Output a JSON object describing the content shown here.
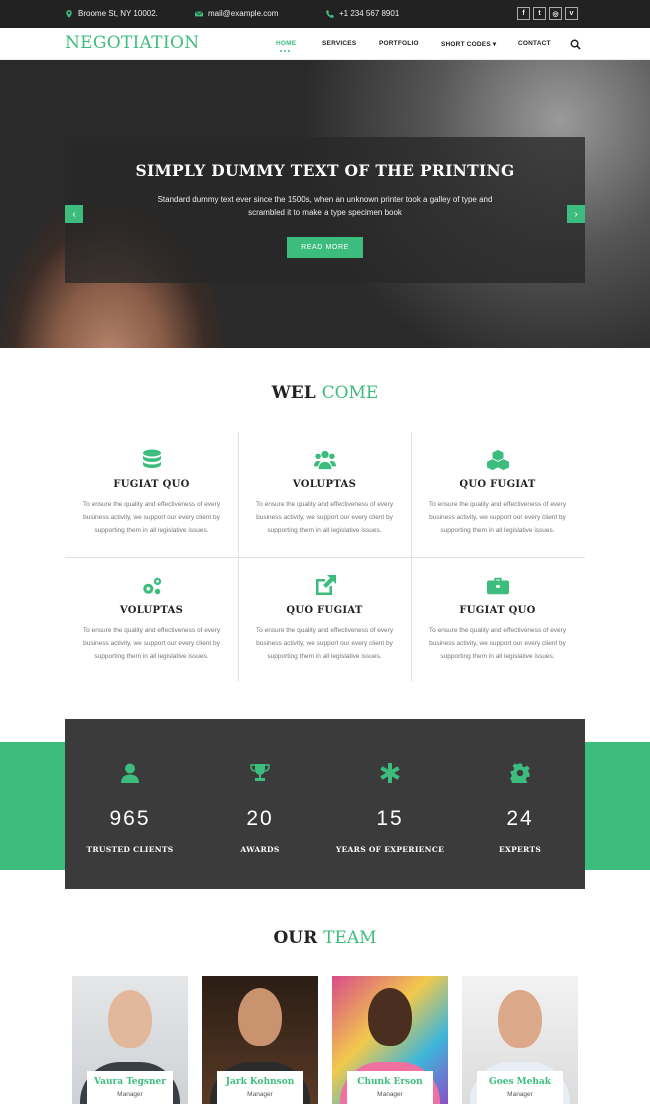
{
  "topbar": {
    "address": "Broome St, NY 10002.",
    "email": "mail@example.com",
    "phone": "+1 234 567 8901",
    "social": [
      "f",
      "t",
      "◎",
      "v"
    ]
  },
  "nav": {
    "logo": "NEGOTIATION",
    "items": [
      "HOME",
      "SERVICES",
      "PORTFOLIO",
      "SHORT CODES ▾",
      "CONTACT"
    ],
    "active": "HOME"
  },
  "hero": {
    "title": "SIMPLY DUMMY TEXT OF THE PRINTING",
    "text": "Standard dummy text ever since the 1500s, when an unknown printer took a galley of type and scrambled it to make a type specimen book",
    "button": "READ MORE",
    "prev": "‹",
    "next": "›"
  },
  "welcome": {
    "title_a": "WEL",
    "title_b": "COME",
    "features": [
      {
        "icon": "database-icon",
        "title": "FUGIAT QUO",
        "text": "To ensure the quality and effectiveness of every business activity, we support our every client by supporting them in all legislative issues."
      },
      {
        "icon": "users-icon",
        "title": "VOLUPTAS",
        "text": "To ensure the quality and effectiveness of every business activity, we support our every client by supporting them in all legislative issues."
      },
      {
        "icon": "cubes-icon",
        "title": "QUO FUGIAT",
        "text": "To ensure the quality and effectiveness of every business activity, we support our every client by supporting them in all legislative issues."
      },
      {
        "icon": "cogs-icon",
        "title": "VOLUPTAS",
        "text": "To ensure the quality and effectiveness of every business activity, we support our every client by supporting them in all legislative issues."
      },
      {
        "icon": "external-link-icon",
        "title": "QUO FUGIAT",
        "text": "To ensure the quality and effectiveness of every business activity, we support our every client by supporting them in all legislative issues."
      },
      {
        "icon": "briefcase-icon",
        "title": "FUGIAT QUO",
        "text": "To ensure the quality and effectiveness of every business activity, we support our every client by supporting them in all legislative issues."
      }
    ]
  },
  "stats": [
    {
      "icon": "user-icon",
      "value": "965",
      "label": "TRUSTED CLIENTS"
    },
    {
      "icon": "trophy-icon",
      "value": "20",
      "label": "AWARDS"
    },
    {
      "icon": "asterisk-icon",
      "value": "15",
      "label": "YEARS OF EXPERIENCE"
    },
    {
      "icon": "gear-icon",
      "value": "24",
      "label": "EXPERTS"
    }
  ],
  "team": {
    "title_a": "OUR",
    "title_b": "TEAM",
    "members": [
      {
        "name": "Vaura Tegsner",
        "role": "Manager"
      },
      {
        "name": "Jark Kohnson",
        "role": "Manager"
      },
      {
        "name": "Chunk Erson",
        "role": "Manager"
      },
      {
        "name": "Goes Mehak",
        "role": "Manager"
      }
    ]
  },
  "colors": {
    "accent": "#3dbd7d",
    "dark": "#222222",
    "panel": "#3b3b3b"
  }
}
